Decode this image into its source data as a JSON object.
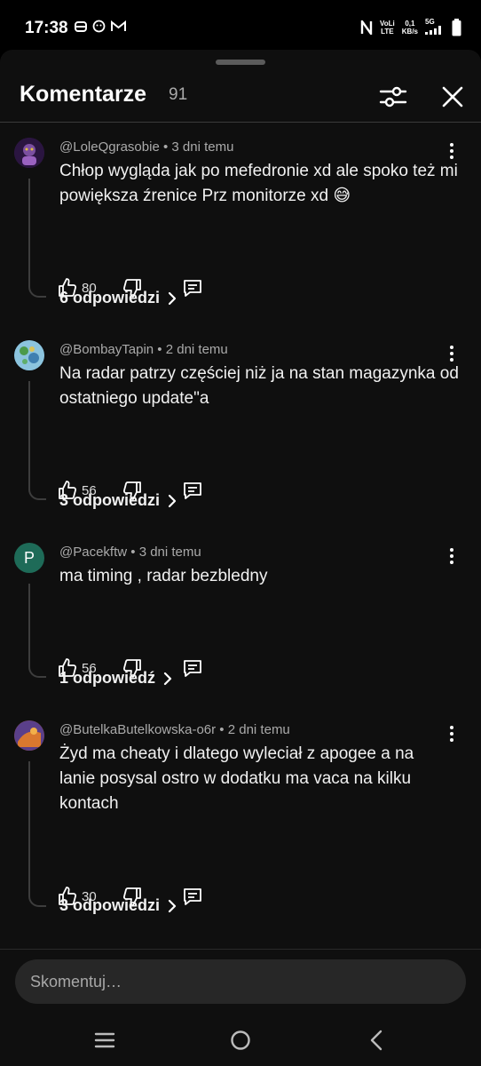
{
  "status_bar": {
    "time": "17:38",
    "left_icons": [
      "notification-icon",
      "face-icon",
      "gmail-icon"
    ],
    "nfc_icon": "nfc-icon",
    "volte_top": "VoLi",
    "volte_bottom": "LTE",
    "speed_value": "0,1",
    "speed_unit": "KB/s",
    "network": "5G",
    "signal_icon": "signal-icon",
    "battery_icon": "battery-icon"
  },
  "header": {
    "title": "Komentarze",
    "count": "91",
    "filter_icon": "filter-icon",
    "close_icon": "close-icon"
  },
  "comments": [
    {
      "author": "@LoleQgrasobie",
      "time": "3 dni temu",
      "text": "Chłop wygląda jak po mefedronie xd ale spoko też mi powiększa źrenice Prz monitorze xd 😅",
      "likes": "80",
      "replies": "6 odpowiedzi",
      "avatar_color": "#3a1e4f"
    },
    {
      "author": "@BombayTapin",
      "time": "2 dni temu",
      "text": "Na radar patrzy częściej niż ja na stan magazynka od ostatniego update\"a",
      "likes": "56",
      "replies": "3 odpowiedzi",
      "avatar_color": "#6aa7c9"
    },
    {
      "author": "@Pacekftw",
      "time": "3 dni temu",
      "text": "ma timing , radar bezbledny",
      "likes": "56",
      "replies": "1 odpowiedź",
      "avatar_letter": "P",
      "avatar_color": "#1e6b58"
    },
    {
      "author": "@ButelkaButelkowska-o6r",
      "time": "2 dni temu",
      "text": "Żyd ma cheaty i dlatego wyleciał z apogee a na lanie posysal ostro w dodatku ma vaca na kilku kontach",
      "likes": "30",
      "replies": "3 odpowiedzi",
      "avatar_color": "#b5612c"
    }
  ],
  "comment_input": {
    "placeholder": "Skomentuj…",
    "value": ""
  },
  "nav": {
    "recent_icon": "recents-icon",
    "home_icon": "home-icon",
    "back_icon": "back-icon"
  },
  "colors": {
    "background": "#0f0f0f",
    "text": "#f1f1f1",
    "secondary_text": "#aaaaaa",
    "input_bg": "#272727"
  }
}
